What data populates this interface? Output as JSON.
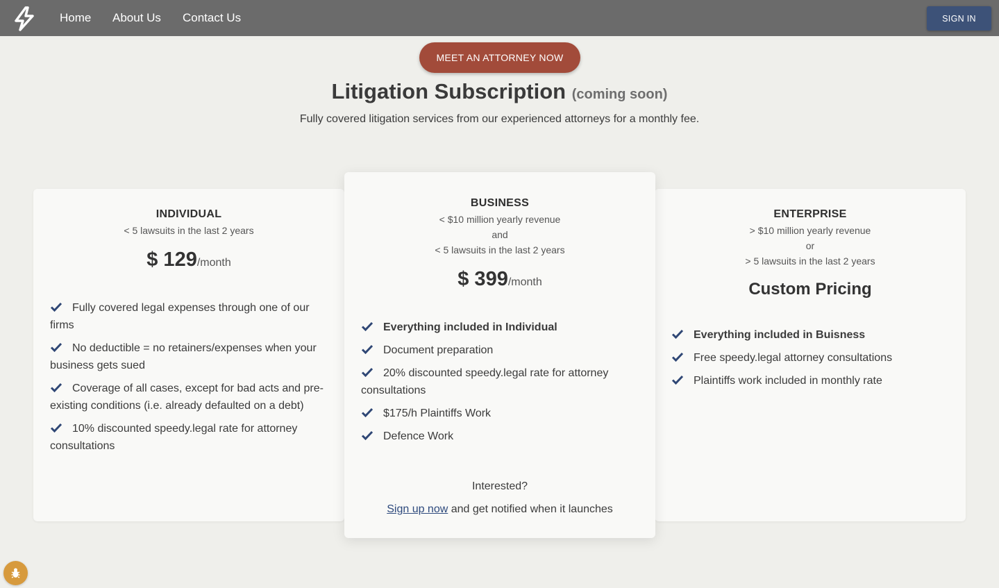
{
  "nav": {
    "logo_icon": "lightning-bolt-icon",
    "links": [
      "Home",
      "About Us",
      "Contact Us"
    ],
    "signin_label": "SIGN IN"
  },
  "hero": {
    "cta_label": "MEET AN ATTORNEY NOW",
    "title": "Litigation Subscription",
    "title_suffix": "(coming soon)",
    "subtitle": "Fully covered litigation services from our experienced attorneys for a monthly fee."
  },
  "plans": {
    "individual": {
      "name": "INDIVIDUAL",
      "desc": [
        "< 5 lawsuits in the last 2 years"
      ],
      "price": "$ 129",
      "per": "/month",
      "features": [
        "Fully covered legal expenses through one of our firms",
        "No deductible = no retainers/expenses when your business gets sued",
        "Coverage of all cases, except for bad acts and pre-existing conditions (i.e. already defaulted on a debt)",
        "10% discounted speedy.legal rate for attorney consultations"
      ]
    },
    "business": {
      "name": "BUSINESS",
      "desc": [
        "< $10 million yearly revenue",
        "and",
        "< 5 lawsuits in the last 2 years"
      ],
      "price": "$ 399",
      "per": "/month",
      "features": [
        "Everything included in Individual",
        "Document preparation",
        "20% discounted speedy.legal rate for attorney consultations",
        "$175/h Plaintiffs Work",
        "Defence Work"
      ],
      "interested": "Interested?",
      "signup_link": "Sign up now",
      "signup_rest": " and get notified when it launches"
    },
    "enterprise": {
      "name": "ENTERPRISE",
      "desc": [
        "> $10 million yearly revenue",
        "or",
        "> 5 lawsuits in the last 2 years"
      ],
      "price": "Custom Pricing",
      "features": [
        "Everything included in Buisness",
        "Free speedy.legal attorney consultations",
        "Plaintiffs work included in monthly rate"
      ]
    }
  },
  "colors": {
    "navbar": "#6b6b6b",
    "cta": "#a24b3a",
    "signin": "#3d5278",
    "check": "#2f4775",
    "bug_button": "#d79a3d"
  },
  "bug_icon": "bug-icon"
}
